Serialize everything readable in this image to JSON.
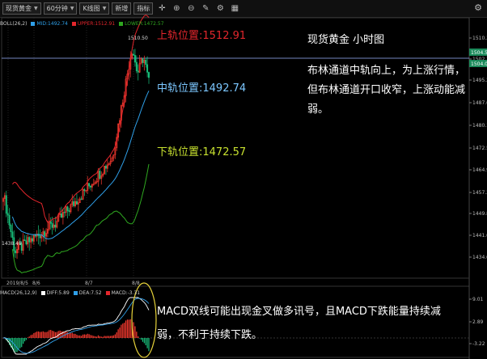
{
  "toolbar": {
    "symbol": "现货黄金",
    "interval": "60分钟",
    "chart_type": "K线图",
    "tool1": "新增",
    "tool2": "指标"
  },
  "legend": {
    "boll": "BOLL(26,2)",
    "mid": "MID:1492.74",
    "upper": "UPPER:1512.91",
    "lower": "LOWER:1472.57"
  },
  "annotations": {
    "upper": "上轨位置:1512.91",
    "mid": "中轨位置:1492.74",
    "lower": "下轨位置:1472.57",
    "high_label": "1510.50",
    "low_label": "1438.49"
  },
  "commentary": {
    "title": "现货黄金 小时图",
    "line1": "布林通道中轨向上，为上涨行情，",
    "line2": "但布林通道开口收窄，上涨动能减",
    "line3": "弱。"
  },
  "price_axis": {
    "ticks": [
      "1510.30",
      "1502.75",
      "1495.20",
      "1487.65",
      "1480.10",
      "1472.55",
      "1464.90",
      "1457.35",
      "1449.80",
      "1441.60",
      "1434.05"
    ],
    "tag1": "1504.50",
    "tag2": "1504.00"
  },
  "date_axis": [
    "2019/8/5",
    "8/6",
    "8/7",
    "8/8"
  ],
  "macd_legend": {
    "name": "MACD(26,12,9)",
    "diff": "DIFF:5.89",
    "dea": "DEA:7.52",
    "macd": "MACD:-3.31"
  },
  "macd_axis": [
    "9.01",
    "2.89",
    "-3.22"
  ],
  "macd_comment": {
    "line1": "MACD双线可能出现金叉做多讯号，且MACD下跌能量持续减",
    "line2": "弱，不利于持续下跌。"
  },
  "colors": {
    "up": "#ff3b30",
    "down": "#19c37d",
    "upper_band": "#e3262c",
    "mid_band": "#2f9fe8",
    "lower_band": "#2fa820",
    "current_price": "#9ab3ff",
    "annotation_upper": "#e3262c",
    "annotation_mid": "#7cc7ff",
    "annotation_lower": "#c7e02f"
  },
  "chart_data": [
    {
      "type": "candlestick",
      "title": "现货黄金 小时图",
      "indicators": [
        "BOLL(26,2)"
      ],
      "ylim": [
        1432,
        1516
      ],
      "bands": {
        "upper": 1512.91,
        "mid": 1492.74,
        "lower": 1472.57
      },
      "max_label": 1510.5,
      "min_label": 1438.49,
      "current_price": 1504.5
    },
    {
      "type": "bar",
      "title": "MACD(26,12,9)",
      "ylim": [
        -4,
        10
      ],
      "diff": 5.89,
      "dea": 7.52,
      "macd": -3.31
    }
  ]
}
